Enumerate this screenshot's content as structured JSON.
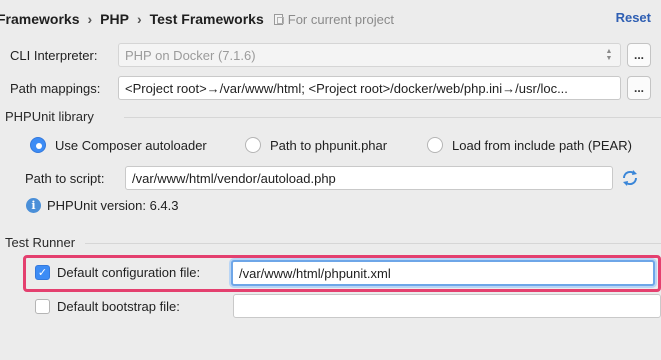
{
  "breadcrumb": {
    "items": [
      "Frameworks",
      "PHP",
      "Test Frameworks"
    ],
    "separator": "›",
    "scope_label": "For current project"
  },
  "header": {
    "reset_label": "Reset"
  },
  "cli": {
    "label": "CLI Interpreter:",
    "value": "PHP on Docker (7.1.6)",
    "browse_label": "..."
  },
  "path_mappings": {
    "label": "Path mappings:",
    "value": "<Project root>→/var/www/html; <Project root>/docker/web/php.ini→/usr/loc...",
    "browse_label": "..."
  },
  "phpunit": {
    "section_title": "PHPUnit library",
    "options": [
      {
        "label": "Use Composer autoloader",
        "checked": true
      },
      {
        "label": "Path to phpunit.phar",
        "checked": false
      },
      {
        "label": "Load from include path (PEAR)",
        "checked": false
      }
    ],
    "path_label": "Path to script:",
    "path_value": "/var/www/html/vendor/autoload.php",
    "version_text": "PHPUnit version: 6.4.3"
  },
  "test_runner": {
    "section_title": "Test Runner",
    "default_config": {
      "label": "Default configuration file:",
      "checked": true,
      "value": "/var/www/html/phpunit.xml"
    },
    "default_bootstrap": {
      "label": "Default bootstrap file:",
      "checked": false,
      "value": ""
    }
  },
  "colors": {
    "accent": "#3d8cf5",
    "highlight": "#e4406f",
    "link": "#2f5fb3"
  },
  "icons": {
    "scope": "document-icon",
    "combo": "combo-arrows-icon",
    "info": "info-icon",
    "reload": "reload-icon",
    "check": "checkmark-icon"
  }
}
